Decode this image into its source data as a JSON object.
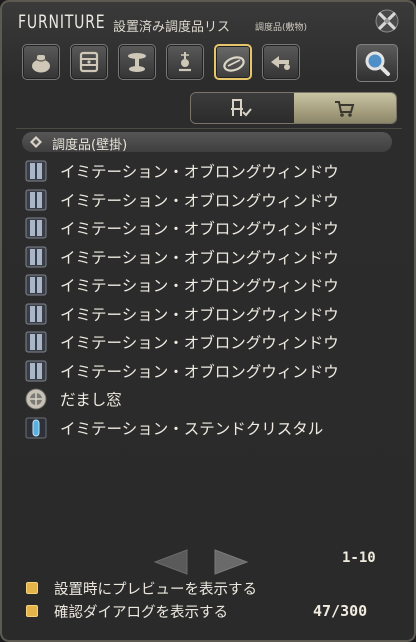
{
  "window": {
    "title": "FURNITURE",
    "subtitle": "設置済み調度品リス",
    "subtitle_note": "調度品(敷物)"
  },
  "category_tabs": [
    {
      "icon": "furniture-bag-icon",
      "selected": false
    },
    {
      "icon": "table-icon",
      "selected": false
    },
    {
      "icon": "tabletop-icon",
      "selected": false
    },
    {
      "icon": "wall-mounted-icon",
      "selected": false
    },
    {
      "icon": "rug-icon",
      "selected": true
    },
    {
      "icon": "outdoor-icon",
      "selected": false
    }
  ],
  "view_toggle": [
    {
      "icon": "chair-check-icon",
      "selected": false
    },
    {
      "icon": "cart-icon",
      "selected": true
    }
  ],
  "list_header": {
    "label": "調度品(壁掛)"
  },
  "items": [
    {
      "label": "イミテーション・オブロングウィンドウ",
      "icon": "window-icon"
    },
    {
      "label": "イミテーション・オブロングウィンドウ",
      "icon": "window-icon"
    },
    {
      "label": "イミテーション・オブロングウィンドウ",
      "icon": "window-icon"
    },
    {
      "label": "イミテーション・オブロングウィンドウ",
      "icon": "window-icon"
    },
    {
      "label": "イミテーション・オブロングウィンドウ",
      "icon": "window-icon"
    },
    {
      "label": "イミテーション・オブロングウィンドウ",
      "icon": "window-icon"
    },
    {
      "label": "イミテーション・オブロングウィンドウ",
      "icon": "window-icon"
    },
    {
      "label": "イミテーション・オブロングウィンドウ",
      "icon": "window-icon"
    },
    {
      "label": "だまし窓",
      "icon": "round-window-icon"
    },
    {
      "label": "イミテーション・ステンドクリスタル",
      "icon": "crystal-icon"
    }
  ],
  "pager": {
    "range": "1-10"
  },
  "options": [
    {
      "label": "設置時にプレビューを表示する",
      "checked": true
    },
    {
      "label": "確認ダイアログを表示する",
      "checked": true
    }
  ],
  "count": "47/300",
  "colors": {
    "accent": "#e7c56a",
    "checkbox": "#e3b44a",
    "panel": "#2a2a2a"
  }
}
